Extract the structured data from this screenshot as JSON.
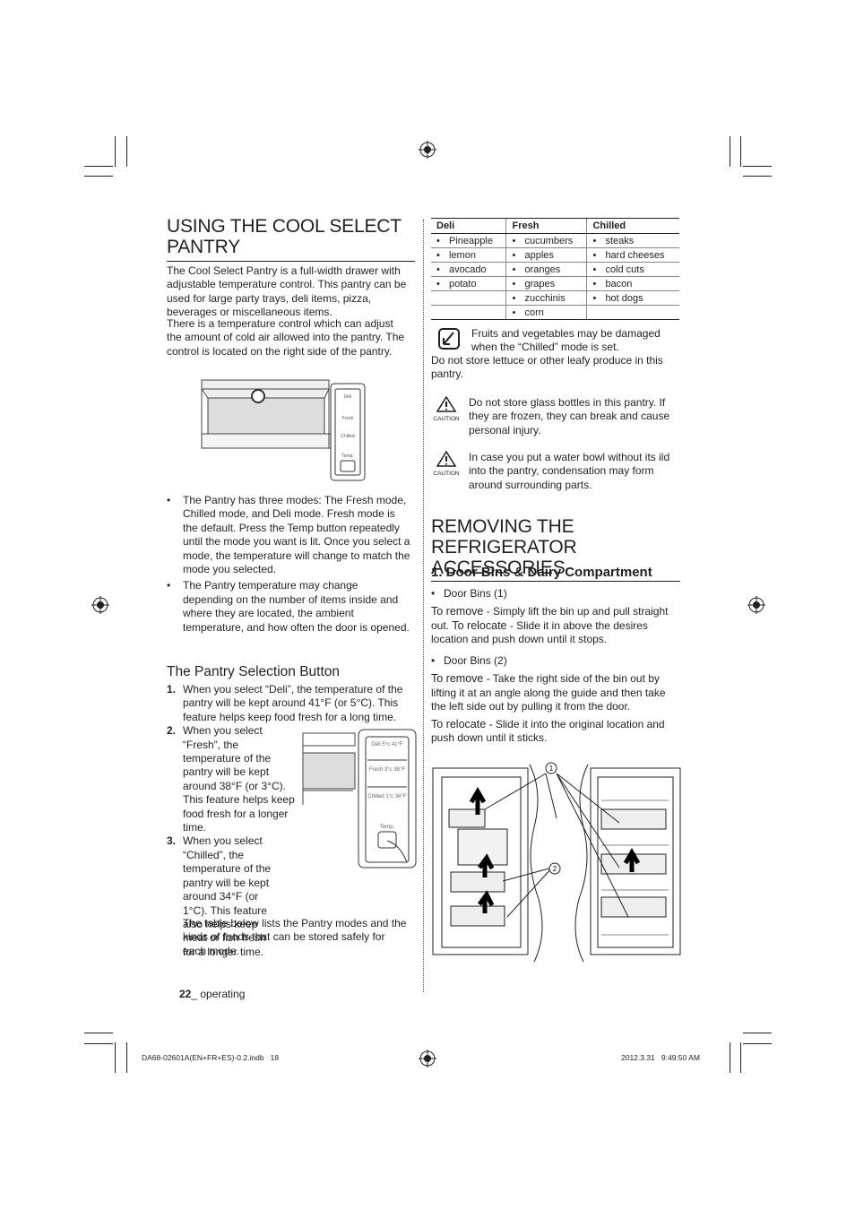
{
  "left": {
    "title": "USING THE COOL SELECT PANTRY",
    "intro1": "The Cool Select Pantry is a full-width drawer with adjustable temperature control. This pantry can be used for large party trays, deli items, pizza, beverages or miscellaneous items.",
    "intro2": "There is a temperature control which can adjust the amount of cold air allowed into the pantry. The control is located on the right side of the pantry.",
    "panel": {
      "deli": "Deli 5°c 41°F",
      "fresh": "Fresh 3°c 38°F",
      "chilled": "Chilled 1°c 34°F",
      "temp": "Temp."
    },
    "bullets": [
      "The Pantry has three modes: The Fresh mode, Chilled mode, and Deli mode. Fresh mode is the default. Press the Temp button repeatedly until the mode you want is lit. Once you select a mode, the temperature will change to match the mode you selected.",
      "The Pantry temperature may change depending on the number of items inside and where they are located, the ambient temperature, and how often the door is opened."
    ],
    "subtitle": "The Pantry Selection Button",
    "steps": [
      {
        "num": "1.",
        "text": "When you select “Deli”, the temperature of the pantry will be kept around 41°F (or 5°C). This feature helps keep food fresh for a long time."
      },
      {
        "num": "2.",
        "text": "When you select “Fresh”, the temperature of the pantry will be kept around 38°F (or 3°C). This feature helps keep food fresh for a longer time."
      },
      {
        "num": "3.",
        "text": "When you select “Chilled”, the temperature of the pantry will be kept around 34°F (or 1°C). This feature also helps keep meat or fish fresh for a longer time."
      }
    ],
    "closing": "The table below lists the Pantry modes and the kinds of foods that can be stored safely for each mode.",
    "footer_page": "22",
    "footer_section": "_ operating"
  },
  "right": {
    "table": {
      "headers": [
        "Deli",
        "Fresh",
        "Chilled"
      ],
      "rows": [
        [
          "Pineapple",
          "cucumbers",
          "steaks"
        ],
        [
          "lemon",
          "apples",
          "hard cheeses"
        ],
        [
          "avocado",
          "oranges",
          "cold cuts"
        ],
        [
          "potato",
          "grapes",
          "bacon"
        ],
        [
          "",
          "zucchinis",
          "hot dogs"
        ],
        [
          "",
          "corn",
          ""
        ]
      ]
    },
    "note": "Fruits and vegetables may be damaged when the “Chilled” mode is set.",
    "note2": "Do not store lettuce or other leafy produce in this pantry.",
    "caution_label": "CAUTION",
    "caution1": "Do not store glass bottles in this pantry. If they are frozen, they can break and cause personal injury.",
    "caution2": "In case you put a water bowl without its ild into the pantry, condensation may form around surrounding parts.",
    "title2": "REMOVING THE REFRIGERATOR ACCESSORIES",
    "sub": "1. Door Bins & Dairy Compartment",
    "bin1": "Door Bins (1)",
    "bin1_remove_label": "To remove",
    "bin1_remove": " - Simply lift the bin up and pull straight out. ",
    "bin1_relocate_label": "To relocate",
    "bin1_relocate": " - Slide it in above the desires location and push down until it stops.",
    "bin2": "Door Bins (2)",
    "bin2_remove_label": "To remove",
    "bin2_remove": " - Take the right side of the bin out by lifting it at an angle along the guide and then take the left side out by pulling it from the door.",
    "bin2_relocate_label": "To relocate",
    "bin2_relocate": " - Slide it into the original location and push down until it sticks.",
    "callout1": "1",
    "callout2": "2"
  },
  "slug": {
    "file": "DA68-02601A(EN+FR+ES)-0.2.indb   18",
    "date": "2012.3.31   9:49:50 AM"
  }
}
